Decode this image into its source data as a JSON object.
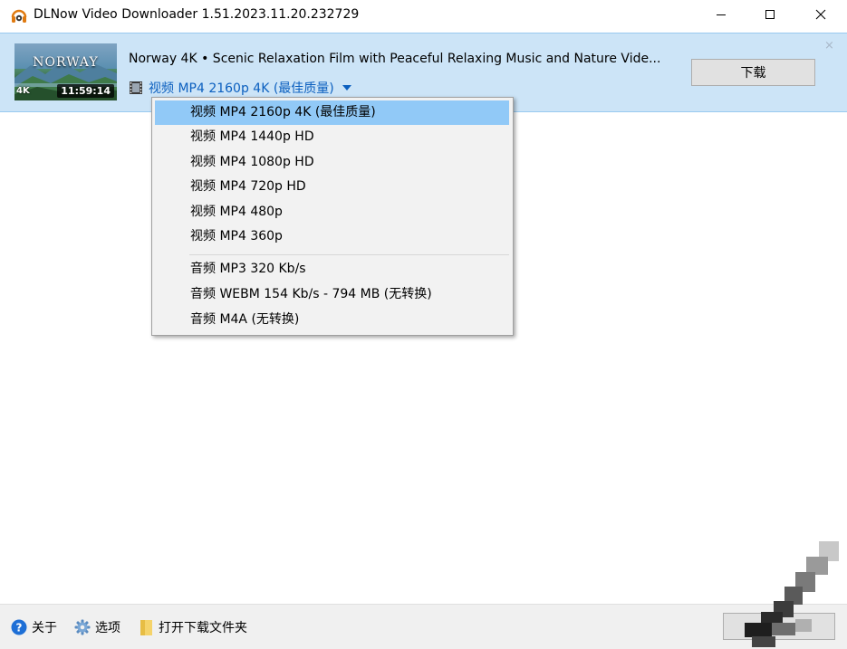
{
  "window": {
    "title": "DLNow Video Downloader 1.51.2023.11.20.232729",
    "icon": "headphones-app-icon"
  },
  "video": {
    "thumbnail_title": "NORWAY",
    "thumbnail_badge": "4K",
    "duration": "11:59:14",
    "title": "Norway 4K • Scenic Relaxation Film with Peaceful Relaxing Music and Nature Vide...",
    "selected_format": "视频 MP4 2160p 4K (最佳质量)",
    "download_label": "下载",
    "dismiss_label": "×"
  },
  "format_menu": {
    "video_options": [
      "视频 MP4 2160p 4K (最佳质量)",
      "视频 MP4 1440p HD",
      "视频 MP4 1080p HD",
      "视频 MP4 720p HD",
      "视频 MP4 480p",
      "视频 MP4 360p"
    ],
    "audio_options": [
      "音频 MP3 320 Kb/s",
      "音频 WEBM 154 Kb/s - 794 MB (无转换)",
      "音频 M4A (无转换)"
    ],
    "selected_index": 0
  },
  "statusbar": {
    "about_label": "关于",
    "options_label": "选项",
    "open_folder_label": "打开下载文件夹"
  },
  "colors": {
    "item_bar_bg": "#cce4f7",
    "link_blue": "#0b5fbf",
    "menu_selected": "#91c9f7",
    "statusbar_bg": "#f0f0f0"
  }
}
